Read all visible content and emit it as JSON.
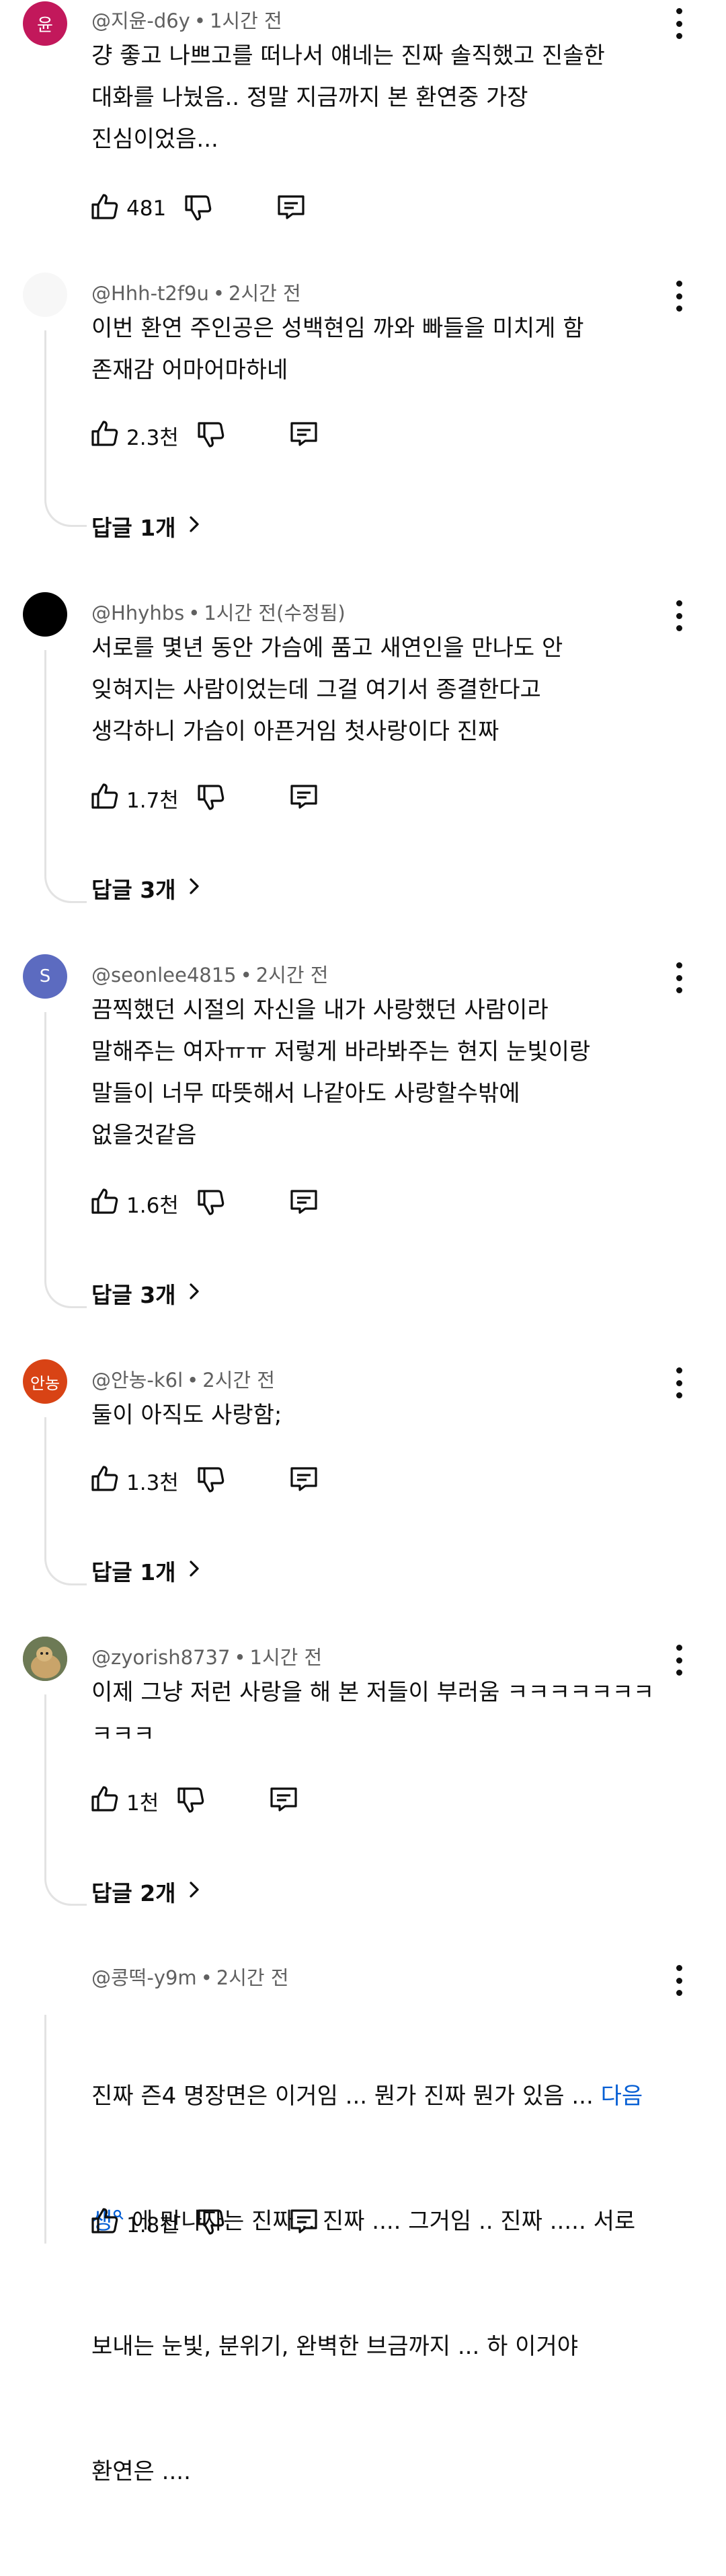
{
  "comments": [
    {
      "avatar_text": "윤",
      "avatar_color": "#c2185b",
      "author": "@지윤-d6y",
      "time": "1시간 전",
      "lines": [
        "걍 좋고 나쁘고를 떠나서 얘네는 진짜 솔직했고 진솔한",
        "대화를 나눴음.. 정말 지금까지 본 환연중 가장",
        "진심이었음..."
      ],
      "likes": "481"
    },
    {
      "avatar_text": "",
      "avatar_color": "#f7f7f7",
      "author": "@Hhh-t2f9u",
      "time": "2시간 전",
      "lines": [
        "이번 환연 주인공은 성백현임 까와 빠들을 미치게 함",
        "존재감 어마어마하네"
      ],
      "likes": "2.3천",
      "replies": "답글 1개"
    },
    {
      "avatar_text": "",
      "avatar_color": "#000000",
      "author": "@Hhyhbs",
      "time": "1시간 전(수정됨)",
      "lines": [
        "서로를 몇년 동안 가슴에 품고 새연인을 만나도 안",
        "잊혀지는 사람이었는데 그걸 여기서 종결한다고",
        "생각하니 가슴이 아픈거임 첫사랑이다 진짜"
      ],
      "likes": "1.7천",
      "replies": "답글 3개"
    },
    {
      "avatar_text": "S",
      "avatar_color": "#5c6bc0",
      "author": "@seonlee4815",
      "time": "2시간 전",
      "lines": [
        "끔찍했던 시절의 자신을 내가 사랑했던 사람이라",
        "말해주는 여자ㅠㅠ 저렇게 바라봐주는 현지 눈빛이랑",
        "말들이 너무 따뜻해서 나같아도 사랑할수밖에",
        "없을것같음"
      ],
      "likes": "1.6천",
      "replies": "답글 3개"
    },
    {
      "avatar_text": "안농",
      "avatar_color": "#d84315",
      "author": "@안농-k6l",
      "time": "2시간 전",
      "lines": [
        "둘이 아직도 사랑함;"
      ],
      "likes": "1.3천",
      "replies": "답글 1개"
    },
    {
      "avatar_text": "",
      "avatar_color": "#8d8465",
      "author": "@zyorish8737",
      "time": "1시간 전",
      "lines": [
        "이제 그냥 저런 사랑을 해 본 저들이 부러움 ㅋㅋㅋㅋㅋㅋㅋ",
        "ㅋㅋㅋ"
      ],
      "likes": "1천",
      "replies": "답글 2개"
    },
    {
      "avatar_text": "",
      "avatar_color": "#ffffff",
      "author": "@콩떡-y9m",
      "time": "2시간 전",
      "line1": "진짜 즌4 명장면은 이거임 ... 뭔가 진짜 뭔가 있음 ... ",
      "link_a": "다음",
      "link_b": "생",
      "line2_rest": " 에 만나자는 진짜 .. 진짜 .... 그거임 .. 진짜 ..... 서로",
      "line3": "보내는 눈빛, 분위기, 완벽한 브금까지 ... 하 이거야",
      "line4": "환연은 ....",
      "likes": "1.8천"
    }
  ]
}
